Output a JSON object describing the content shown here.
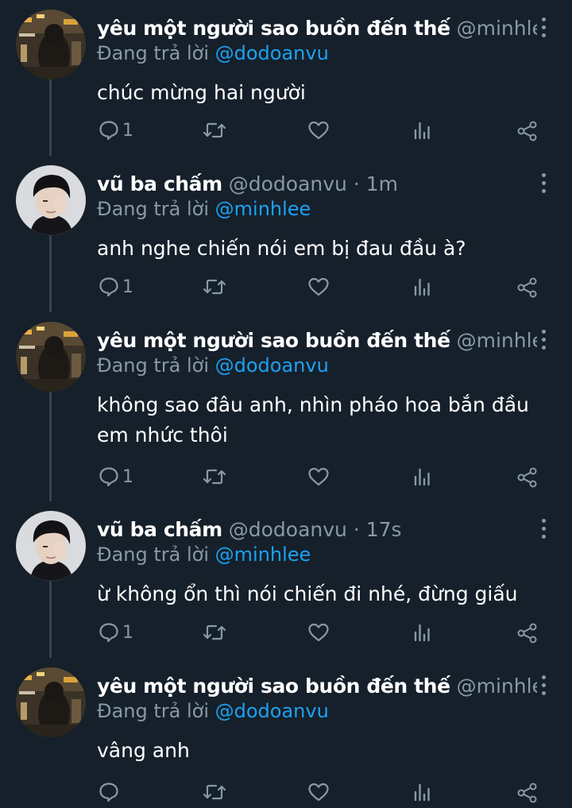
{
  "colors": {
    "background": "#15202b",
    "text_primary": "#ffffff",
    "text_secondary": "#8899a6",
    "mention": "#1da1f2",
    "thread_line": "#38444d"
  },
  "icons": {
    "more": "vertical-ellipsis-icon",
    "reply": "comment-bubble-icon",
    "retweet": "retweet-icon",
    "like": "heart-icon",
    "views": "bar-chart-icon",
    "share": "share-icon"
  },
  "tweets": [
    {
      "name": "yêu một người sao buồn đến thế",
      "handle": "@minhlee ·...",
      "replying_prefix": "Đang trả lời ",
      "replying_to": "@dodoanvu",
      "text": "chúc mừng hai người",
      "reply_count": "1"
    },
    {
      "name": "vũ ba chấm",
      "handle": "@dodoanvu · 1m",
      "replying_prefix": "Đang trả lời ",
      "replying_to": "@minhlee",
      "text": "anh nghe chiến nói em bị đau đầu à?",
      "reply_count": "1"
    },
    {
      "name": "yêu một người sao buồn đến thế",
      "handle": "@minhlee ·...",
      "replying_prefix": "Đang trả lời ",
      "replying_to": "@dodoanvu",
      "text": "không sao đâu anh, nhìn pháo hoa bắn đầu em nhức thôi",
      "reply_count": "1"
    },
    {
      "name": "vũ ba chấm",
      "handle": "@dodoanvu · 17s",
      "replying_prefix": "Đang trả lời ",
      "replying_to": "@minhlee",
      "text": "ừ không ổn thì nói chiến đi nhé, đừng giấu",
      "reply_count": "1"
    },
    {
      "name": "yêu một người sao buồn đến thế",
      "handle": "@minhlee ·...",
      "replying_prefix": "Đang trả lời ",
      "replying_to": "@dodoanvu",
      "text": "vâng anh",
      "reply_count": ""
    }
  ]
}
